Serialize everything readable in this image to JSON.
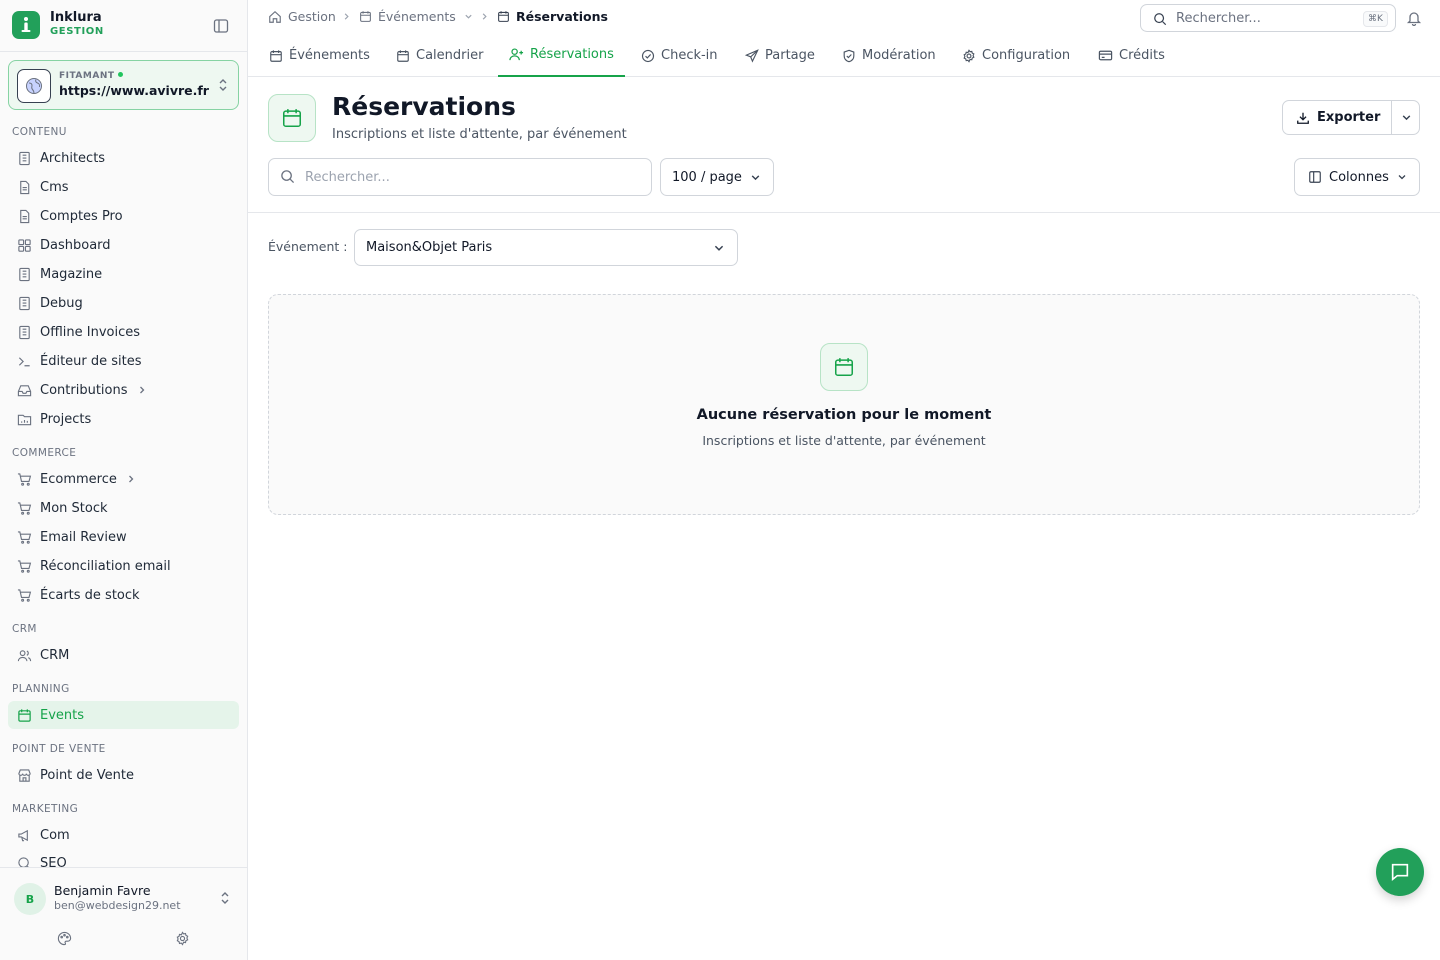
{
  "brand": {
    "name": "Inklura",
    "subtitle": "GESTION"
  },
  "site": {
    "label": "FITAMANT",
    "url": "https://www.avivre.fr"
  },
  "sidebar": {
    "sections": [
      {
        "title": "CONTENU",
        "items": [
          {
            "label": "Architects",
            "icon": "building-icon"
          },
          {
            "label": "Cms",
            "icon": "file-text-icon"
          },
          {
            "label": "Comptes Pro",
            "icon": "file-text-icon"
          },
          {
            "label": "Dashboard",
            "icon": "layout-grid-icon"
          },
          {
            "label": "Magazine",
            "icon": "building-icon"
          },
          {
            "label": "Debug",
            "icon": "building-icon"
          },
          {
            "label": "Offline Invoices",
            "icon": "building-icon"
          },
          {
            "label": "Éditeur de sites",
            "icon": "terminal-icon"
          },
          {
            "label": "Contributions",
            "icon": "inbox-icon",
            "has_children": true
          },
          {
            "label": "Projects",
            "icon": "folder-icon"
          }
        ]
      },
      {
        "title": "COMMERCE",
        "items": [
          {
            "label": "Ecommerce",
            "icon": "cart-icon",
            "has_children": true
          },
          {
            "label": "Mon Stock",
            "icon": "cart-icon"
          },
          {
            "label": "Email Review",
            "icon": "cart-icon"
          },
          {
            "label": "Réconciliation email",
            "icon": "cart-icon"
          },
          {
            "label": "Écarts de stock",
            "icon": "cart-icon"
          }
        ]
      },
      {
        "title": "CRM",
        "items": [
          {
            "label": "CRM",
            "icon": "users-icon"
          }
        ]
      },
      {
        "title": "PLANNING",
        "items": [
          {
            "label": "Events",
            "icon": "calendar-icon",
            "active": true
          }
        ]
      },
      {
        "title": "POINT DE VENTE",
        "items": [
          {
            "label": "Point de Vente",
            "icon": "store-icon"
          }
        ]
      },
      {
        "title": "MARKETING",
        "items": [
          {
            "label": "Com",
            "icon": "megaphone-icon"
          },
          {
            "label": "SEO",
            "icon": "search-icon"
          }
        ]
      }
    ]
  },
  "user": {
    "initial": "B",
    "name": "Benjamin Favre",
    "email": "ben@webdesign29.net"
  },
  "breadcrumb": [
    {
      "label": "Gestion",
      "icon": "home-icon"
    },
    {
      "label": "Événements",
      "icon": "calendar-icon",
      "dropdown": true
    },
    {
      "label": "Réservations",
      "icon": "calendar-icon",
      "current": true
    }
  ],
  "global_search": {
    "placeholder": "Rechercher...",
    "shortcut": "⌘K"
  },
  "tabs": [
    {
      "label": "Événements",
      "icon": "calendar-icon"
    },
    {
      "label": "Calendrier",
      "icon": "calendar-icon"
    },
    {
      "label": "Réservations",
      "icon": "user-plus-icon",
      "active": true
    },
    {
      "label": "Check-in",
      "icon": "check-circle-icon"
    },
    {
      "label": "Partage",
      "icon": "send-icon"
    },
    {
      "label": "Modération",
      "icon": "shield-icon"
    },
    {
      "label": "Configuration",
      "icon": "gear-icon"
    },
    {
      "label": "Crédits",
      "icon": "credit-card-icon"
    }
  ],
  "page": {
    "title": "Réservations",
    "subtitle": "Inscriptions et liste d'attente, par événement"
  },
  "toolbar": {
    "export_label": "Exporter",
    "search_placeholder": "Rechercher...",
    "search_value": "",
    "per_page": "100 / page",
    "columns_label": "Colonnes"
  },
  "filter": {
    "label": "Événement :",
    "selected": "Maison&Objet Paris"
  },
  "empty_state": {
    "title": "Aucune réservation pour le moment",
    "subtitle": "Inscriptions et liste d'attente, par événement"
  },
  "colors": {
    "accent": "#22a05a",
    "accent_text": "#16a34a"
  }
}
